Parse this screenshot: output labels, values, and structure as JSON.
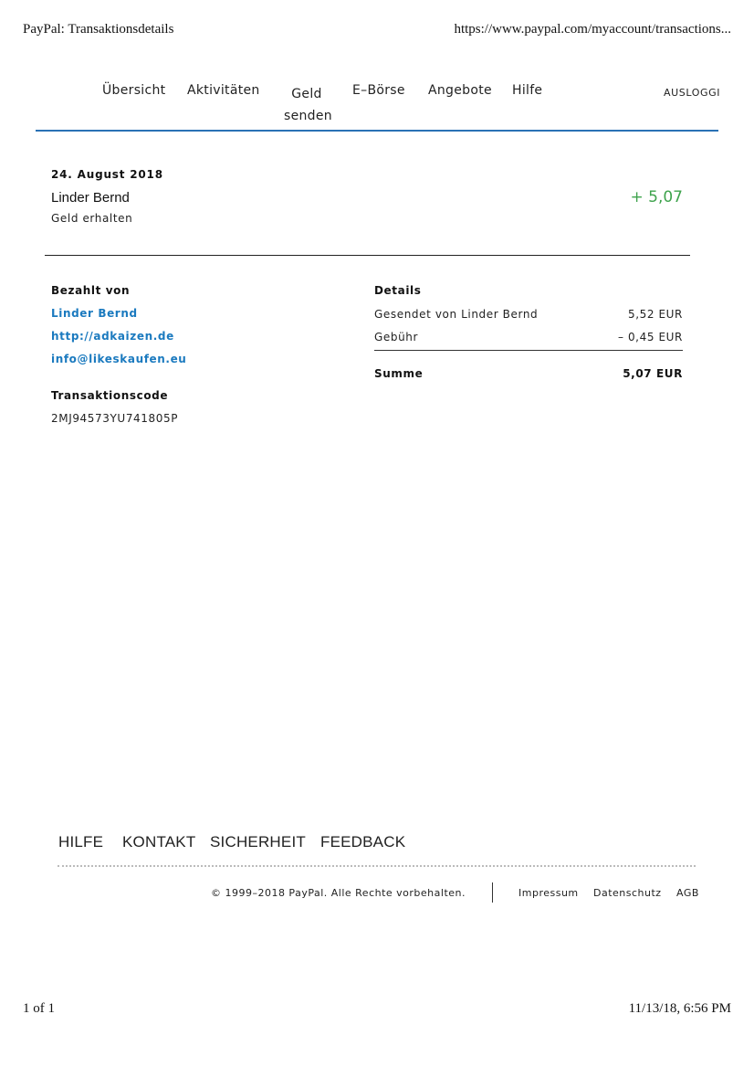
{
  "print_header": {
    "title": "PayPal: Transaktionsdetails",
    "url": "https://www.paypal.com/myaccount/transactions..."
  },
  "nav": {
    "overview": "Übersicht",
    "activities": "Aktivitäten",
    "send_money_line1": "Geld",
    "send_money_line2": "senden",
    "ebourse": "E–Börse",
    "offers": "Angebote",
    "help": "Hilfe",
    "logout": "AUSLOGGI"
  },
  "transaction": {
    "date": "24. August 2018",
    "name": "Linder Bernd",
    "type": "Geld erhalten",
    "amount": "+ 5,07"
  },
  "paid_by": {
    "heading": "Bezahlt von",
    "name": "Linder Bernd",
    "website": "http://adkaizen.de",
    "email": "info@likeskaufen.eu"
  },
  "transaction_code": {
    "heading": "Transaktionscode",
    "value": "2MJ94573YU741805P"
  },
  "details": {
    "heading": "Details",
    "rows": [
      {
        "label": "Gesendet von Linder Bernd",
        "value": "5,52 EUR"
      },
      {
        "label": "Gebühr",
        "value": "– 0,45 EUR"
      }
    ],
    "total_label": "Summe",
    "total_value": "5,07 EUR"
  },
  "footer": {
    "links": [
      "HILFE",
      "KONTAKT",
      "SICHERHEIT",
      "FEEDBACK"
    ],
    "copyright": "© 1999–2018 PayPal. Alle Rechte vorbehalten.",
    "legal": [
      "Impressum",
      "Datenschutz",
      "AGB"
    ]
  },
  "print_footer": {
    "page": "1 of 1",
    "datetime": "11/13/18, 6:56 PM"
  },
  "colors": {
    "accent_blue": "#2a72b5",
    "link_blue": "#1b7abf",
    "amount_green": "#3fa34d"
  }
}
